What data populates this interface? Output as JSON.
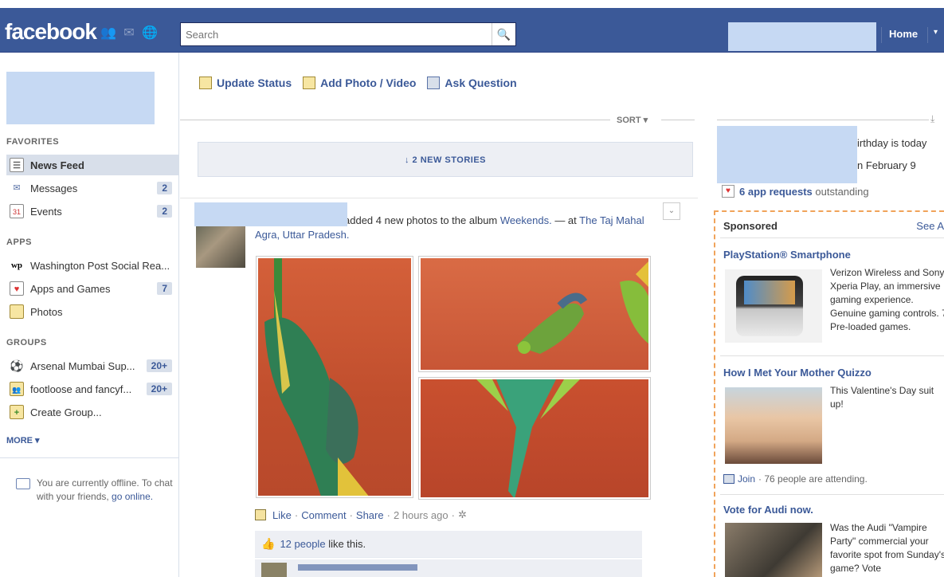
{
  "header": {
    "logo": "facebook",
    "search_placeholder": "Search",
    "home_label": "Home",
    "menu_caret": "▾"
  },
  "left_nav": {
    "favorites_heading": "FAVORITES",
    "favorites": [
      {
        "label": "News Feed",
        "count": "",
        "icon": "news-feed-icon"
      },
      {
        "label": "Messages",
        "count": "2",
        "icon": "messages-icon"
      },
      {
        "label": "Events",
        "count": "2",
        "icon": "events-icon"
      }
    ],
    "apps_heading": "APPS",
    "apps": [
      {
        "label": "Washington Post Social Rea...",
        "count": "",
        "icon": "washington-post-icon"
      },
      {
        "label": "Apps and Games",
        "count": "7",
        "icon": "apps-games-icon"
      },
      {
        "label": "Photos",
        "count": "",
        "icon": "photos-icon"
      }
    ],
    "groups_heading": "GROUPS",
    "groups": [
      {
        "label": "Arsenal Mumbai Sup...",
        "count": "20+",
        "icon": "soccer-ball-icon"
      },
      {
        "label": "footloose and fancyf...",
        "count": "20+",
        "icon": "group-icon"
      },
      {
        "label": "Create Group...",
        "count": "",
        "icon": "create-group-icon"
      }
    ],
    "more_label": "MORE ▾",
    "offline_text": "You are currently offline. To chat with your friends,",
    "offline_link": "go online."
  },
  "composer": {
    "update_status": "Update Status",
    "add_photo": "Add Photo / Video",
    "ask_question": "Ask Question"
  },
  "feed": {
    "sort_label": "SORT ▾",
    "new_stories": "↓  2 NEW STORIES",
    "story": {
      "action_text": "added 4 new photos to the album",
      "album": "Weekends.",
      "at_text": "— at",
      "place": "The Taj Mahal",
      "location": "Agra, Uttar Pradesh.",
      "like": "Like",
      "comment": "Comment",
      "share": "Share",
      "time": "2 hours ago",
      "likes_count": "12 people",
      "likes_suffix": "like this."
    }
  },
  "right": {
    "bday_line1": "irthday is today",
    "bday_line2": "n February 9",
    "app_requests": "6 app requests",
    "app_requests_suffix": "outstanding",
    "sponsored_heading": "Sponsored",
    "see_all": "See A",
    "ads": [
      {
        "title": "PlayStation® Smartphone",
        "text": "Verizon Wireless and Sony Xperia Play, an immersive gaming experience. Genuine gaming controls. 7 Pre-loaded games."
      },
      {
        "title": "How I Met Your Mother Quizzo",
        "text": "This Valentine's Day suit up!",
        "join_label": "Join",
        "join_suffix": "· 76 people are attending."
      },
      {
        "title": "Vote for Audi now.",
        "text": "Was the Audi \"Vampire Party\" commercial your favorite spot from Sunday's game? Vote"
      }
    ]
  }
}
